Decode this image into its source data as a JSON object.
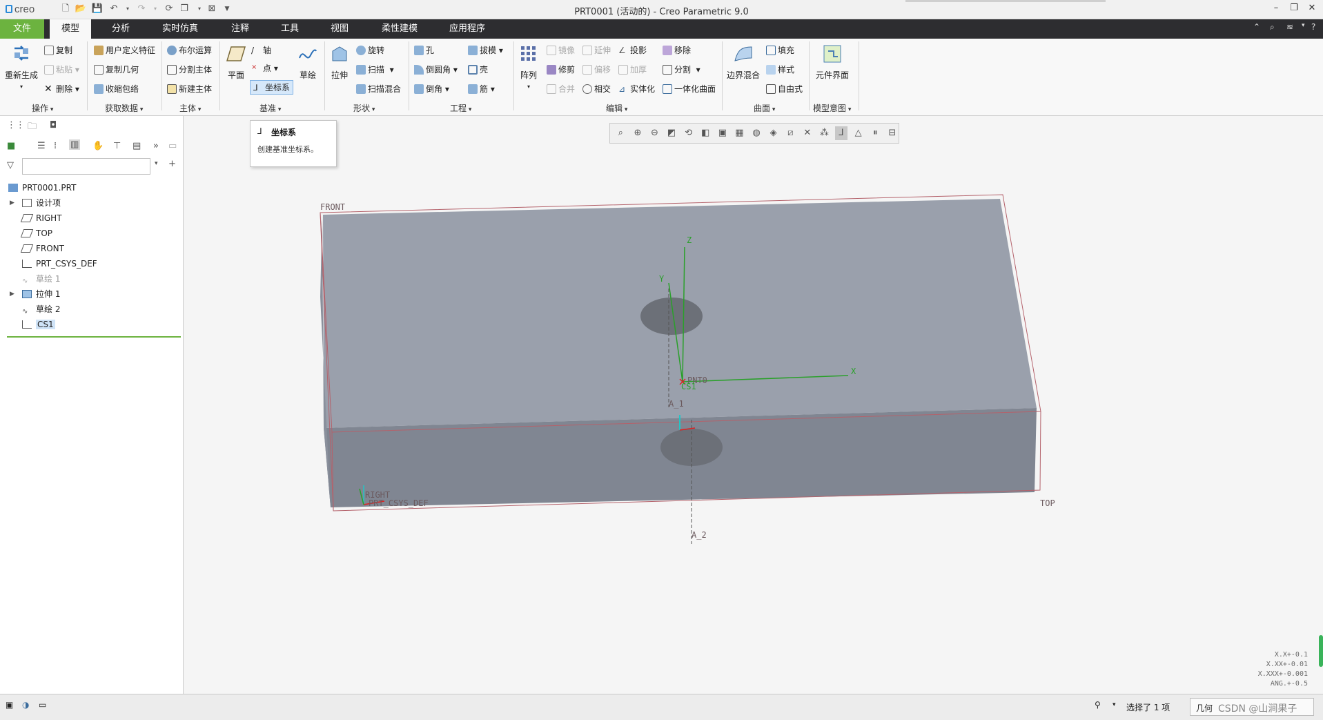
{
  "app": {
    "logo": "creo",
    "window_title": "PRT0001 (活动的) - Creo Parametric 9.0"
  },
  "tabs": [
    "文件",
    "模型",
    "分析",
    "实时仿真",
    "注释",
    "工具",
    "视图",
    "柔性建模",
    "应用程序"
  ],
  "ribbon": {
    "ops": {
      "regenerate": "重新生成",
      "copy": "复制",
      "paste": "粘贴",
      "delete": "删除",
      "group": "操作"
    },
    "getdata": {
      "udf": "用户定义特征",
      "copy_geom": "复制几何",
      "shrinkwrap": "收缩包络",
      "group": "获取数据"
    },
    "body": {
      "boolean": "布尔运算",
      "split": "分割主体",
      "new": "新建主体",
      "group": "主体"
    },
    "datum": {
      "plane": "平面",
      "axis": "轴",
      "point": "点",
      "csys": "坐标系",
      "sketch": "草绘",
      "group": "基准"
    },
    "shapes": {
      "extrude": "拉伸",
      "revolve": "旋转",
      "sweep": "扫描",
      "swept_blend": "扫描混合",
      "group": "形状"
    },
    "eng": {
      "hole": "孔",
      "round": "倒圆角",
      "chamfer": "倒角",
      "draft": "拔模",
      "shell": "壳",
      "rib": "筋",
      "group": "工程"
    },
    "edit": {
      "pattern": "阵列",
      "mirror": "镜像",
      "trim": "修剪",
      "merge": "合并",
      "extend": "延伸",
      "offset": "偏移",
      "intersect": "相交",
      "project": "投影",
      "thicken": "加厚",
      "solidify": "实体化",
      "remove": "移除",
      "split": "分割",
      "unify": "一体化曲面",
      "group": "编辑"
    },
    "surfaces": {
      "boundary": "边界混合",
      "fill": "填充",
      "style": "样式",
      "freestyle": "自由式",
      "group": "曲面"
    },
    "intent": {
      "skeleton": "元件界面",
      "group": "模型意图"
    }
  },
  "tooltip": {
    "title": "坐标系",
    "desc": "创建基准坐标系。"
  },
  "tree": {
    "items": [
      "PRT0001.PRT",
      "设计项",
      "RIGHT",
      "TOP",
      "FRONT",
      "PRT_CSYS_DEF",
      "草绘 1",
      "拉伸 1",
      "草绘 2",
      "CS1"
    ]
  },
  "model_labels": {
    "front": "FRONT",
    "top": "TOP",
    "right": "RIGHT",
    "prt_csys": "PRT_CSYS_DEF",
    "pnt": "PNT0",
    "cs1": "CS1",
    "a1": "A_1",
    "a2": "A_2",
    "x": "X",
    "y": "Y",
    "z": "Z"
  },
  "tolerance": [
    "X.X+-0.1",
    "X.XX+-0.01",
    "X.XXX+-0.001",
    "ANG.+-0.5"
  ],
  "status": {
    "selection": "选择了 1 项",
    "filter": "几何",
    "watermark": "CSDN @山涧果子"
  },
  "colors": {
    "accent_green": "#6cb33f",
    "tab_bar": "#2d2d30",
    "model_face": "#9aa0ac",
    "datum_edge": "#b4626b"
  }
}
